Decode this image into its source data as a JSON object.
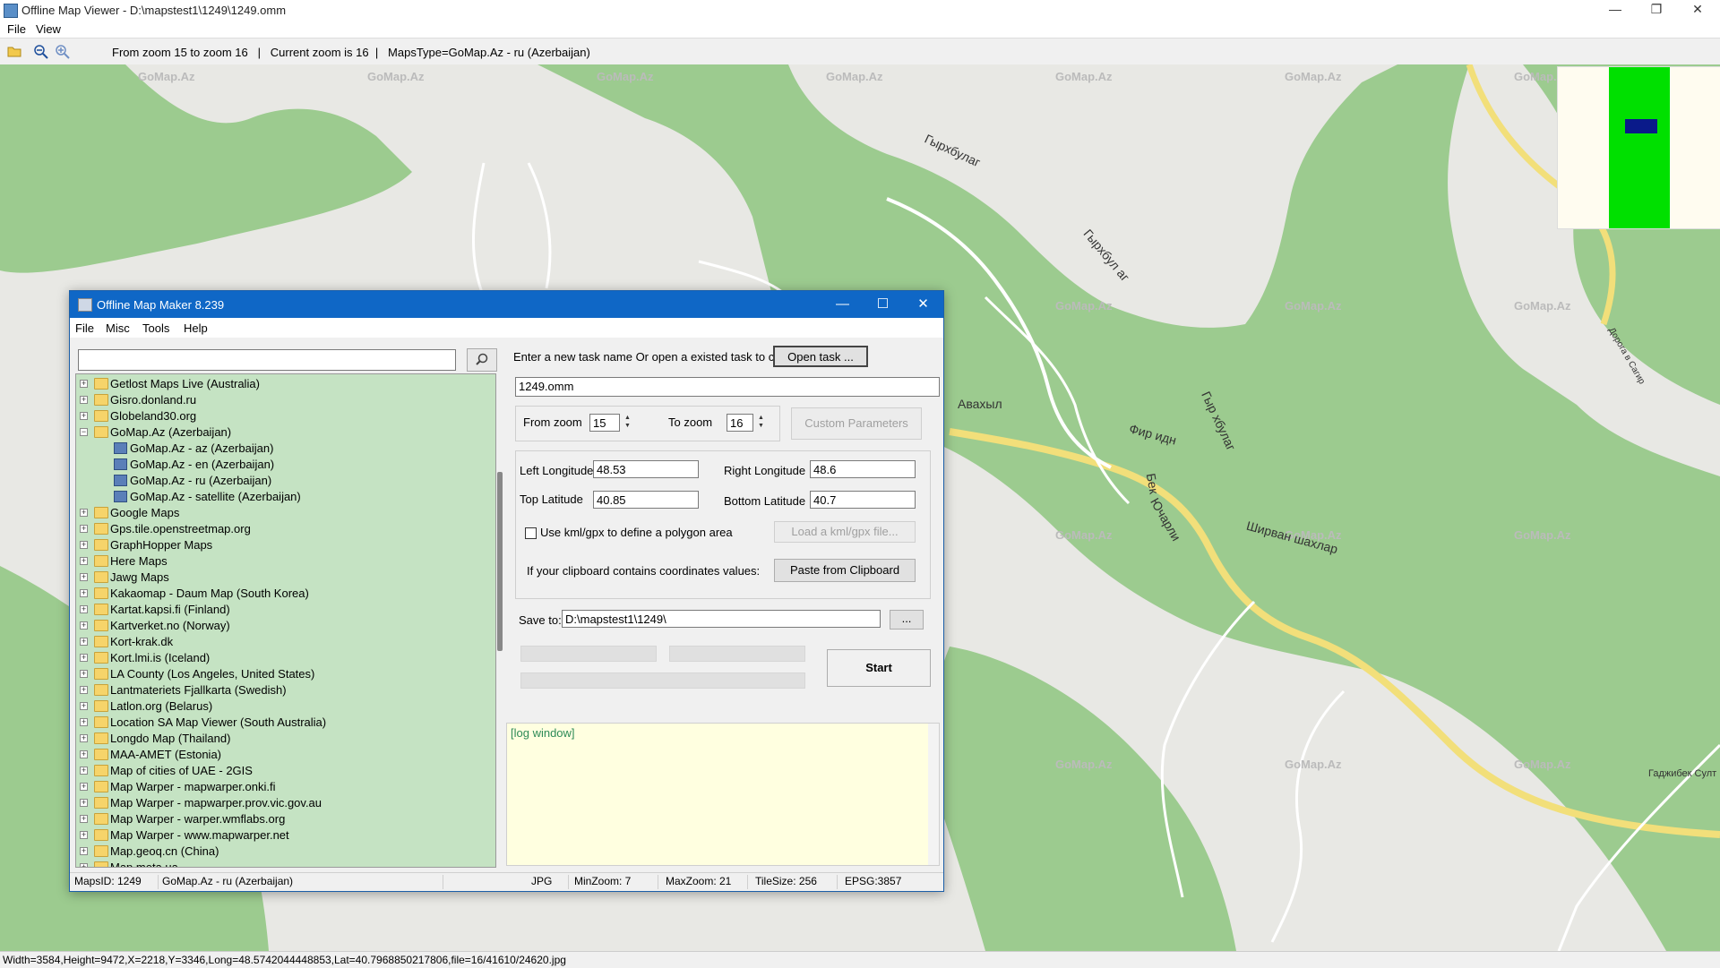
{
  "window": {
    "title": "Offline Map Viewer - D:\\mapstest1\\1249\\1249.omm",
    "minimize": "—",
    "maximize": "❐",
    "close": "✕"
  },
  "menu": {
    "file": "File",
    "view": "View"
  },
  "toolbar": {
    "info": "From zoom 15 to zoom 16   |   Current zoom is 16  |   MapsType=GoMap.Az - ru (Azerbaijan)"
  },
  "map": {
    "watermark": "GoMap.Az",
    "labels": {
      "l1": "Гырхбулаг",
      "l2": "Гырхбул аг",
      "l3": "Авахыл",
      "l4": "Фир идн",
      "l5": "Бек",
      "l6": "Ючарли",
      "l7": "Гыр хбулаг",
      "l8": "Ширван шахлар",
      "l9": "Дорога в Сагир",
      "l10": "Гаджибек Султ"
    }
  },
  "status": {
    "text": "Width=3584,Height=9472,X=2218,Y=3346,Long=48.5742044448853,Lat=40.7968850217806,file=16/41610/24620.jpg"
  },
  "dialog": {
    "title": "Offline Map Maker 8.239",
    "minimize": "—",
    "maximize": "☐",
    "close": "✕",
    "menu": {
      "file": "File",
      "misc": "Misc",
      "tools": "Tools",
      "help": "Help"
    },
    "search": {
      "value": "",
      "icon": "search-icon"
    },
    "tree": [
      {
        "label": "Getlost Maps Live (Australia)",
        "type": "folder"
      },
      {
        "label": "Gisro.donland.ru",
        "type": "folder"
      },
      {
        "label": "Globeland30.org",
        "type": "folder"
      },
      {
        "label": "GoMap.Az (Azerbaijan)",
        "type": "folder-open"
      },
      {
        "label": "GoMap.Az - az (Azerbaijan)",
        "type": "map"
      },
      {
        "label": "GoMap.Az - en (Azerbaijan)",
        "type": "map"
      },
      {
        "label": "GoMap.Az - ru (Azerbaijan)",
        "type": "map"
      },
      {
        "label": "GoMap.Az - satellite (Azerbaijan)",
        "type": "map"
      },
      {
        "label": "Google Maps",
        "type": "folder"
      },
      {
        "label": "Gps.tile.openstreetmap.org",
        "type": "folder"
      },
      {
        "label": "GraphHopper Maps",
        "type": "folder"
      },
      {
        "label": "Here Maps",
        "type": "folder"
      },
      {
        "label": "Jawg Maps",
        "type": "folder"
      },
      {
        "label": "Kakaomap - Daum Map (South Korea)",
        "type": "folder"
      },
      {
        "label": "Kartat.kapsi.fi (Finland)",
        "type": "folder"
      },
      {
        "label": "Kartverket.no (Norway)",
        "type": "folder"
      },
      {
        "label": "Kort-krak.dk",
        "type": "folder"
      },
      {
        "label": "Kort.lmi.is (Iceland)",
        "type": "folder"
      },
      {
        "label": "LA County (Los Angeles, United States)",
        "type": "folder"
      },
      {
        "label": "Lantmateriets Fjallkarta (Swedish)",
        "type": "folder"
      },
      {
        "label": "Latlon.org (Belarus)",
        "type": "folder"
      },
      {
        "label": "Location SA Map Viewer (South Australia)",
        "type": "folder"
      },
      {
        "label": "Longdo Map (Thailand)",
        "type": "folder"
      },
      {
        "label": "MAA-AMET (Estonia)",
        "type": "folder"
      },
      {
        "label": "Map of cities of UAE - 2GIS",
        "type": "folder"
      },
      {
        "label": "Map Warper - mapwarper.onki.fi",
        "type": "folder"
      },
      {
        "label": "Map Warper - mapwarper.prov.vic.gov.au",
        "type": "folder"
      },
      {
        "label": "Map Warper - warper.wmflabs.org",
        "type": "folder"
      },
      {
        "label": "Map Warper - www.mapwarper.net",
        "type": "folder"
      },
      {
        "label": "Map.geoq.cn (China)",
        "type": "folder"
      },
      {
        "label": "Map.meta.ua",
        "type": "folder"
      }
    ],
    "task": {
      "prompt": "Enter a new task name Or open a existed task to continue:",
      "open_button": "Open task ...",
      "name": "1249.omm"
    },
    "zoom": {
      "from_label": "From zoom",
      "from_value": "15",
      "to_label": "To zoom",
      "to_value": "16",
      "custom_button": "Custom Parameters"
    },
    "coords": {
      "left_lon_label": "Left Longitude",
      "left_lon": "48.53",
      "right_lon_label": "Right Longitude",
      "right_lon": "48.6",
      "top_lat_label": "Top Latitude",
      "top_lat": "40.85",
      "bottom_lat_label": "Bottom Latitude",
      "bottom_lat": "40.7",
      "kml_label": "Use kml/gpx to define a polygon area",
      "kml_button": "Load a kml/gpx file...",
      "clipboard_label": "If your clipboard contains coordinates values:",
      "clipboard_button": "Paste from Clipboard"
    },
    "save": {
      "label": "Save to:",
      "path": "D:\\mapstest1\\1249\\",
      "browse": "..."
    },
    "start_button": "Start",
    "log": "[log window]",
    "statusbar": {
      "maps_id": "MapsID: 1249",
      "maps_name": "GoMap.Az - ru (Azerbaijan)",
      "format": "JPG",
      "min_zoom": "MinZoom: 7",
      "max_zoom": "MaxZoom: 21",
      "tile_size": "TileSize: 256",
      "epsg": "EPSG:3857"
    }
  },
  "colors": {
    "map_green": "#9ccb8f",
    "map_land": "#e8e8e4",
    "road_yellow": "#f2df7a",
    "tree_bg": "#c5e3c3",
    "title_blue": "#0f67c6",
    "minimap_green": "#00e000",
    "minimap_blue": "#0a1a8a"
  }
}
